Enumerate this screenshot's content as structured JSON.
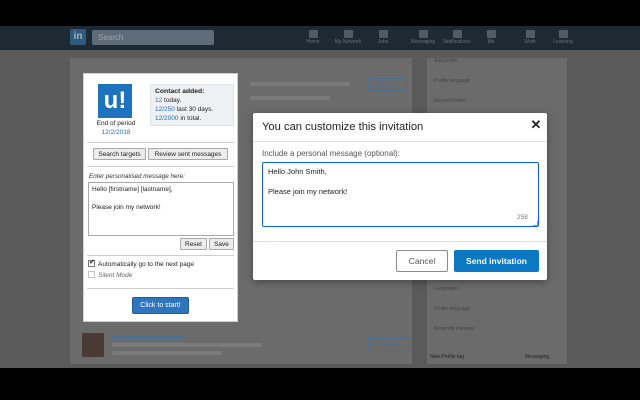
{
  "background": {
    "search_placeholder": "Search",
    "logo_text": "in",
    "nav": [
      {
        "icon": "home-icon",
        "label": "Home"
      },
      {
        "icon": "network-icon",
        "label": "My Network"
      },
      {
        "icon": "jobs-icon",
        "label": "Jobs"
      },
      {
        "icon": "messaging-icon",
        "label": "Messaging"
      },
      {
        "icon": "notifications-icon",
        "label": "Notifications"
      },
      {
        "icon": "me-icon",
        "label": "Me"
      },
      {
        "icon": "work-icon",
        "label": "Work"
      },
      {
        "icon": "learning-icon",
        "label": "Learning"
      }
    ],
    "connect_label": "Connect",
    "side_items": [
      "Add profile",
      "Profile language",
      "Recent Profile",
      "Languages",
      "Profile language",
      "Nonprofit interests"
    ],
    "messaging_label": "Messaging",
    "new_profile_label": "New Profile tag"
  },
  "extension": {
    "logo_text": "u!",
    "period_label": "End of period",
    "period_date": "12/2/2018",
    "contact_title": "Contact added:",
    "stats": [
      {
        "num": "12",
        "text": "today."
      },
      {
        "num": "12/250",
        "text": "last 30 days."
      },
      {
        "num": "12/2000",
        "text": "in total."
      }
    ],
    "search_targets": "Search targets",
    "review_sent": "Review sent messages",
    "hint": "Enter personalised message here:",
    "message": "Hello [firstname] [lastname],\n\nPlease join my network!",
    "reset": "Reset",
    "save": "Save",
    "auto_next": "Automatically go to the next page",
    "silent_mode": "Silent Mode",
    "start": "Click to start!"
  },
  "modal": {
    "title": "You can customize this invitation",
    "label": "Include a personal message (optional):",
    "message": "Hello John Smith,\n\nPlease join my network!",
    "counter": "258",
    "cancel": "Cancel",
    "send": "Send invitation"
  }
}
